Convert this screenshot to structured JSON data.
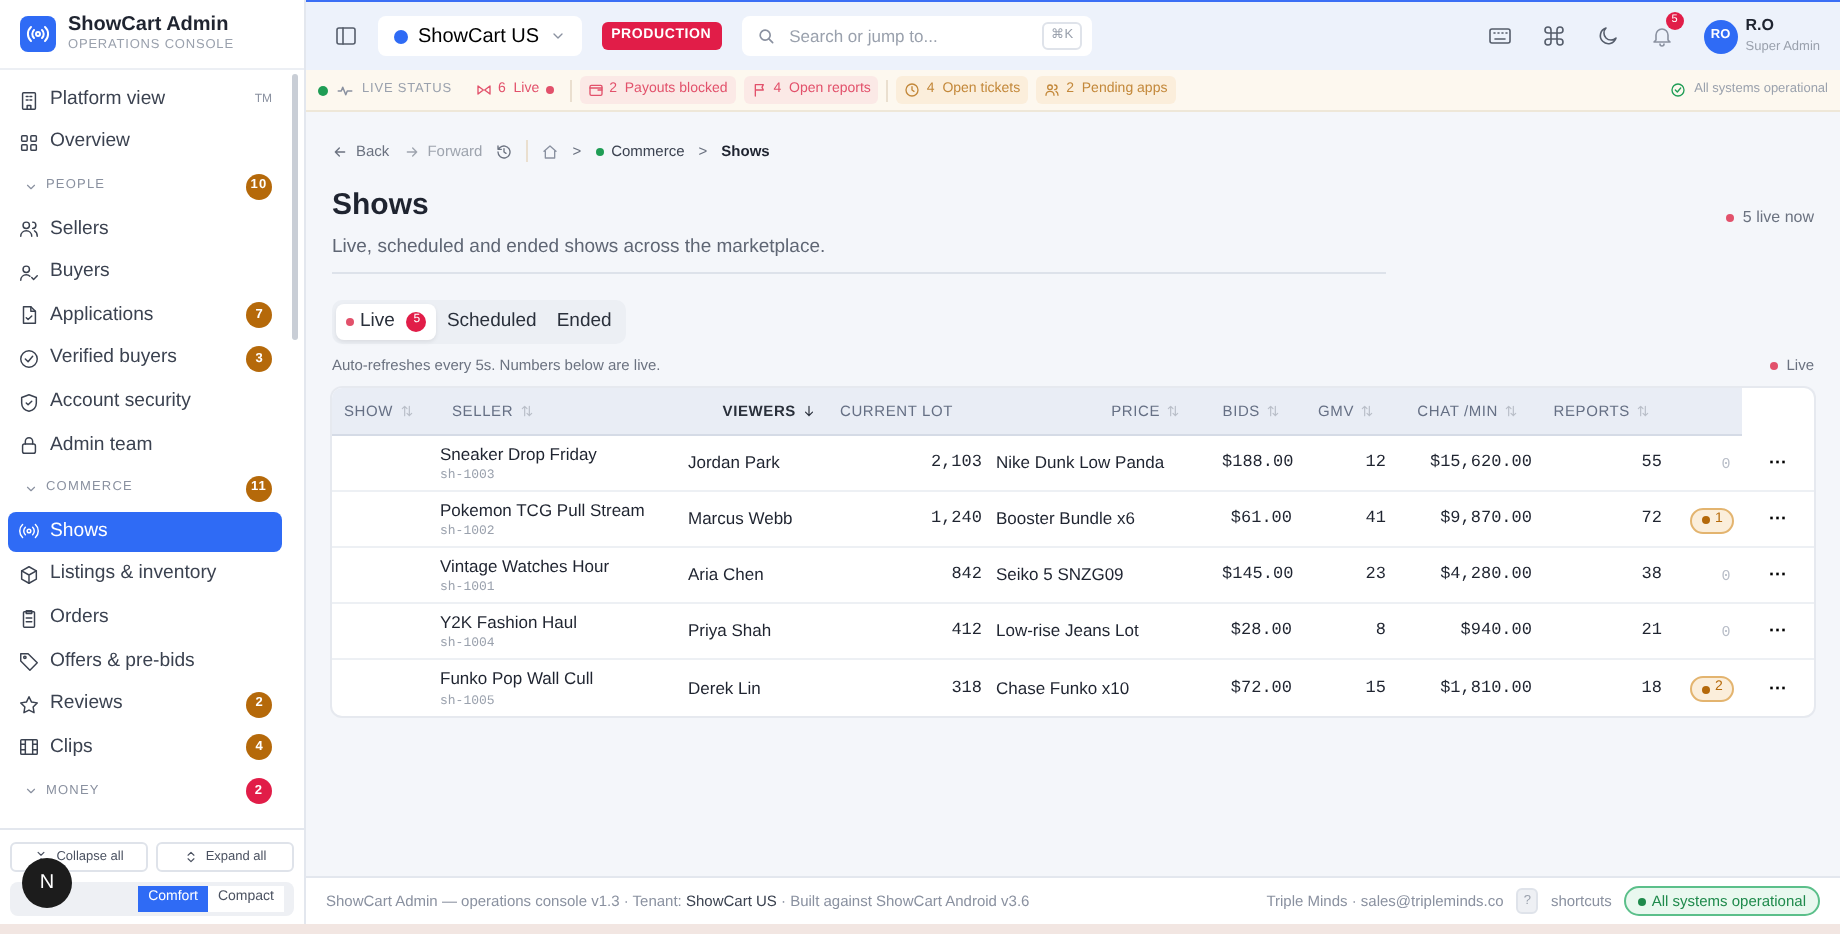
{
  "brand": {
    "title": "ShowCart Admin",
    "subtitle": "OPERATIONS CONSOLE"
  },
  "sidebar": {
    "items": [
      {
        "kind": "item",
        "label": "Platform view",
        "tag": "TM",
        "selected": false
      },
      {
        "kind": "item",
        "label": "Overview",
        "selected": false
      },
      {
        "kind": "section",
        "label": "PEOPLE",
        "count": "10",
        "color": "#b5690a",
        "expanded": true
      },
      {
        "kind": "item",
        "label": "Sellers",
        "selected": false
      },
      {
        "kind": "item",
        "label": "Buyers",
        "selected": false
      },
      {
        "kind": "item",
        "label": "Applications",
        "count": "7",
        "color": "#b5690a",
        "selected": false
      },
      {
        "kind": "item",
        "label": "Verified buyers",
        "count": "3",
        "color": "#b5690a",
        "selected": false
      },
      {
        "kind": "item",
        "label": "Account security",
        "selected": false
      },
      {
        "kind": "item",
        "label": "Admin team",
        "selected": false
      },
      {
        "kind": "section",
        "label": "COMMERCE",
        "count": "11",
        "color": "#b5690a",
        "expanded": true
      },
      {
        "kind": "item",
        "label": "Shows",
        "selected": true
      },
      {
        "kind": "item",
        "label": "Listings & inventory",
        "selected": false
      },
      {
        "kind": "item",
        "label": "Orders",
        "selected": false
      },
      {
        "kind": "item",
        "label": "Offers & pre-bids",
        "selected": false
      },
      {
        "kind": "item",
        "label": "Reviews",
        "count": "2",
        "color": "#b5690a",
        "selected": false
      },
      {
        "kind": "item",
        "label": "Clips",
        "count": "4",
        "color": "#b5690a",
        "selected": false
      },
      {
        "kind": "section",
        "label": "MONEY",
        "count": "2",
        "color": "#e11d48",
        "expanded": true
      }
    ],
    "footer_buttons": [
      "Collapse all",
      "Expand all"
    ],
    "dev_badge": "N",
    "density": [
      {
        "label": "Comfort",
        "selected": true
      },
      {
        "label": "Compact",
        "selected": false
      }
    ]
  },
  "topbar": {
    "tenant": "ShowCart US",
    "environment": "PRODUCTION",
    "search": {
      "placeholder": "Search or jump to...",
      "shortcut": "⌘K"
    },
    "notifications": "5",
    "user": {
      "initials": "RO",
      "name": "R.O",
      "role": "Super Admin"
    }
  },
  "status_strip": {
    "label": "LIVE STATUS",
    "pills": [
      {
        "kind": "live",
        "count": "6",
        "label": "Live"
      },
      {
        "kind": "danger",
        "count": "2",
        "label": "Payouts blocked"
      },
      {
        "kind": "danger",
        "count": "4",
        "label": "Open reports"
      },
      {
        "kind": "warning",
        "count": "4",
        "label": "Open tickets"
      },
      {
        "kind": "warning",
        "count": "2",
        "label": "Pending apps"
      }
    ],
    "health": "All systems operational"
  },
  "breadcrumb": {
    "back": "Back",
    "forward": "Forward",
    "forward_disabled": true,
    "separator": ">",
    "trail": [
      "Commerce",
      "Shows"
    ]
  },
  "page": {
    "title": "Shows",
    "subtitle": "Live, scheduled and ended shows across the marketplace.",
    "live_now": "5 live now"
  },
  "tabs": [
    {
      "label": "Live",
      "count": "5",
      "selected": true
    },
    {
      "label": "Scheduled",
      "selected": false
    },
    {
      "label": "Ended",
      "selected": false
    }
  ],
  "note": "Auto-refreshes every 5s. Numbers below are live.",
  "live_indicator": "Live",
  "table": {
    "columns": [
      {
        "label": "SHOW",
        "sortable": true,
        "sorted": false
      },
      {
        "label": "SELLER",
        "sortable": true,
        "sorted": false
      },
      {
        "label": "VIEWERS",
        "sortable": true,
        "sorted": true
      },
      {
        "label": "CURRENT LOT",
        "sortable": false,
        "sorted": false
      },
      {
        "label": "PRICE",
        "sortable": true,
        "sorted": false
      },
      {
        "label": "BIDS",
        "sortable": true,
        "sorted": false
      },
      {
        "label": "GMV",
        "sortable": true,
        "sorted": false
      },
      {
        "label": "CHAT /MIN",
        "sortable": true,
        "sorted": false
      },
      {
        "label": "REPORTS",
        "sortable": true,
        "sorted": false
      }
    ],
    "rows": [
      {
        "show": "Sneaker Drop Friday",
        "show_id": "sh-1003",
        "seller": "Jordan Park",
        "viewers": "2,103",
        "current_lot": "Nike Dunk Low Panda",
        "price": "$188.00",
        "bids": "12",
        "gmv": "$15,620.00",
        "chat_per_min": "55",
        "reports": {
          "text": "0",
          "flagged": false
        }
      },
      {
        "show": "Pokemon TCG Pull Stream",
        "show_id": "sh-1002",
        "seller": "Marcus Webb",
        "viewers": "1,240",
        "current_lot": "Booster Bundle x6",
        "price": "$61.00",
        "bids": "41",
        "gmv": "$9,870.00",
        "chat_per_min": "72",
        "reports": {
          "text": "1",
          "flagged": true
        }
      },
      {
        "show": "Vintage Watches Hour",
        "show_id": "sh-1001",
        "seller": "Aria Chen",
        "viewers": "842",
        "current_lot": "Seiko 5 SNZG09",
        "price": "$145.00",
        "bids": "23",
        "gmv": "$4,280.00",
        "chat_per_min": "38",
        "reports": {
          "text": "0",
          "flagged": false
        }
      },
      {
        "show": "Y2K Fashion Haul",
        "show_id": "sh-1004",
        "seller": "Priya Shah",
        "viewers": "412",
        "current_lot": "Low-rise Jeans Lot",
        "price": "$28.00",
        "bids": "8",
        "gmv": "$940.00",
        "chat_per_min": "21",
        "reports": {
          "text": "0",
          "flagged": false
        }
      },
      {
        "show": "Funko Pop Wall Cull",
        "show_id": "sh-1005",
        "seller": "Derek Lin",
        "viewers": "318",
        "current_lot": "Chase Funko x10",
        "price": "$72.00",
        "bids": "15",
        "gmv": "$1,810.00",
        "chat_per_min": "18",
        "reports": {
          "text": "2",
          "flagged": true
        }
      }
    ],
    "row_action": "···"
  },
  "footer": {
    "text": "ShowCart Admin — operations console v1.3 · Tenant: **ShowCart US** · Built against ShowCart Android v3.6",
    "contact": "Triple Minds · sales@tripleminds.co",
    "shortcut_key": "?",
    "shortcut_label": "shortcuts",
    "health": "All systems operational"
  }
}
